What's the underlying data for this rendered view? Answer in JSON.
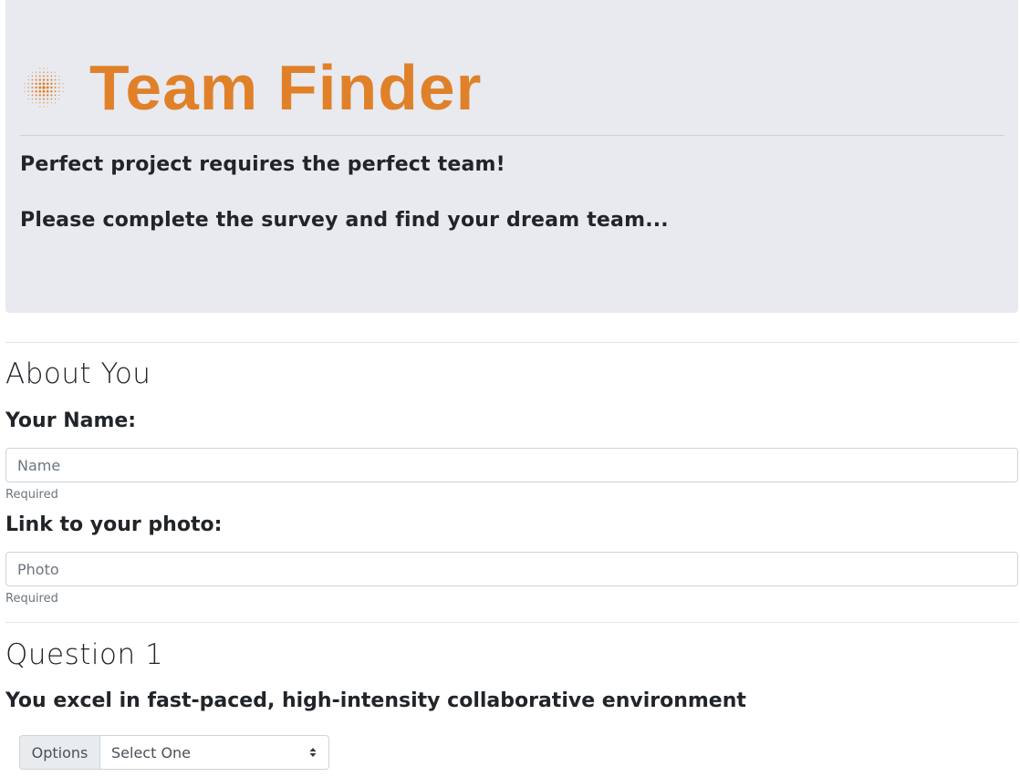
{
  "header": {
    "title": "Team Finder",
    "logo_icon": "radial-dots-icon",
    "tagline": "Perfect project requires the perfect team!",
    "subtitle": "Please complete the survey and find your dream team..."
  },
  "colors": {
    "brand": "#e0812a",
    "jumbotron_bg": "#e8eaef"
  },
  "about_section": {
    "title": "About You",
    "name_label": "Your Name:",
    "name_placeholder": "Name",
    "name_value": "",
    "name_help": "Required",
    "photo_label": "Link to your photo:",
    "photo_placeholder": "Photo",
    "photo_value": "",
    "photo_help": "Required"
  },
  "question_1": {
    "title": "Question 1",
    "text": "You excel in fast-paced, high-intensity collaborative environment",
    "options_label": "Options",
    "selected_value": "Select One"
  }
}
